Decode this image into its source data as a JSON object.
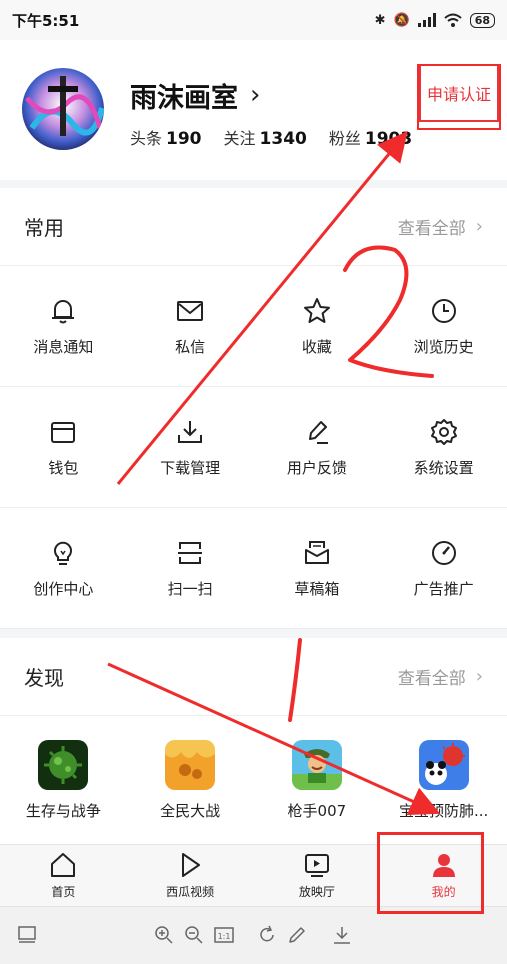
{
  "status_bar": {
    "time": "下午5:51",
    "battery": "68"
  },
  "profile": {
    "username": "雨沫画室",
    "certify_button": "申请认证",
    "stats": [
      {
        "label": "头条",
        "value": "190"
      },
      {
        "label": "关注",
        "value": "1340"
      },
      {
        "label": "粉丝",
        "value": "1903"
      }
    ]
  },
  "common_section": {
    "title": "常用",
    "see_all": "查看全部",
    "rows": [
      [
        {
          "label": "消息通知",
          "icon": "bell-icon"
        },
        {
          "label": "私信",
          "icon": "mail-icon"
        },
        {
          "label": "收藏",
          "icon": "star-icon"
        },
        {
          "label": "浏览历史",
          "icon": "clock-icon"
        }
      ],
      [
        {
          "label": "钱包",
          "icon": "wallet-icon"
        },
        {
          "label": "下载管理",
          "icon": "download-icon"
        },
        {
          "label": "用户反馈",
          "icon": "feedback-pen-icon"
        },
        {
          "label": "系统设置",
          "icon": "gear-icon"
        }
      ],
      [
        {
          "label": "创作中心",
          "icon": "lightbulb-icon"
        },
        {
          "label": "扫一扫",
          "icon": "scan-icon"
        },
        {
          "label": "草稿箱",
          "icon": "drafts-icon"
        },
        {
          "label": "广告推广",
          "icon": "gauge-icon"
        }
      ]
    ]
  },
  "discover_section": {
    "title": "发现",
    "see_all": "查看全部",
    "apps": [
      {
        "label": "生存与战争",
        "icon": "virus-game-icon"
      },
      {
        "label": "全民大战",
        "icon": "orange-game-icon"
      },
      {
        "label": "枪手007",
        "icon": "gunner-game-icon"
      },
      {
        "label": "宝宝预防肺...",
        "icon": "panda-game-icon"
      }
    ]
  },
  "bottom_nav": [
    {
      "label": "首页",
      "icon": "home-icon",
      "active": false
    },
    {
      "label": "西瓜视频",
      "icon": "play-icon",
      "active": false
    },
    {
      "label": "放映厅",
      "icon": "tv-play-icon",
      "active": false
    },
    {
      "label": "我的",
      "icon": "person-icon",
      "active": true
    }
  ],
  "annotations": {
    "number_one": "1",
    "number_two": "2",
    "color": "#ef2b2b"
  },
  "colors": {
    "accent": "#e8353c",
    "annotation": "#ef2b2b"
  }
}
